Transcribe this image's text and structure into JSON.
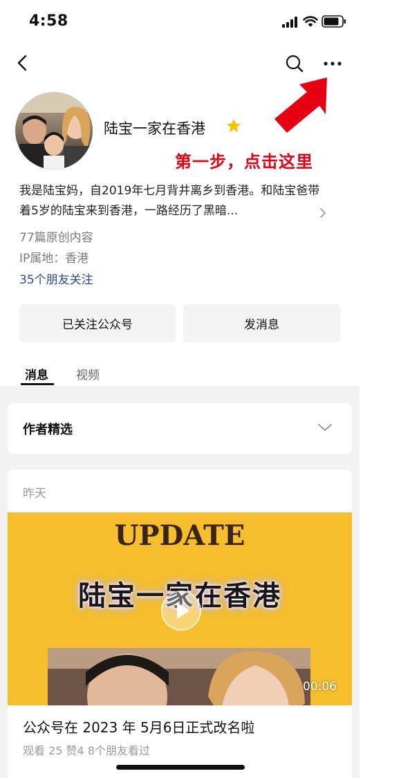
{
  "status_bar": {
    "time": "4:58"
  },
  "account": {
    "name": "陆宝一家在香港",
    "description": "我是陆宝妈，自2019年七月背井离乡到香港。和陆宝爸带着5岁的陆宝来到香港，一路经历了黑暗...",
    "original_count": "77篇原创内容",
    "ip_location": "IP属地：香港",
    "friends_following": "35个朋友关注"
  },
  "annotation": {
    "text": "第一步，点击这里",
    "color": "#e60012"
  },
  "buttons": {
    "followed": "已关注公众号",
    "send_message": "发消息"
  },
  "tabs": [
    {
      "label": "消息",
      "active": true
    },
    {
      "label": "视频",
      "active": false
    }
  ],
  "author_picks": {
    "title": "作者精选"
  },
  "post": {
    "date": "昨天",
    "video_text_top": "UPDATE",
    "video_text_title": "陆宝一家在香港",
    "video_duration": "00:06",
    "title": "公众号在 2023 年 5月6日正式改名啦",
    "stats": "观看 25  赞4  8个朋友看过"
  },
  "icons": {
    "back": "chevron-left-icon",
    "search": "search-icon",
    "more": "more-dots-icon",
    "star": "star-icon",
    "play": "play-icon",
    "chevron_down": "chevron-down-icon",
    "chevron_right": "chevron-right-icon"
  },
  "colors": {
    "accent_link": "#2b4a8f",
    "annotation_red": "#e60012",
    "star": "#f7c300",
    "video_bg": "#f6bd2c"
  }
}
